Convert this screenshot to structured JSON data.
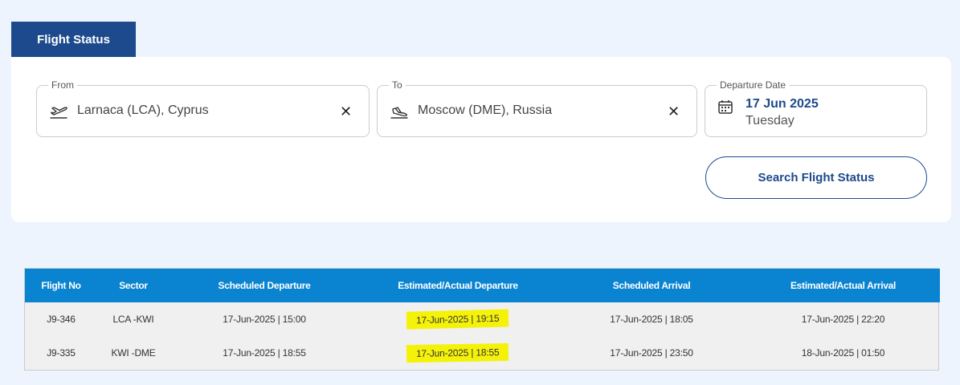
{
  "tab": {
    "label": "Flight Status"
  },
  "search": {
    "from": {
      "legend": "From",
      "value": "Larnaca (LCA), Cyprus",
      "icon": "plane-takeoff-icon"
    },
    "to": {
      "legend": "To",
      "value": "Moscow (DME), Russia",
      "icon": "plane-landing-icon"
    },
    "departure_date": {
      "legend": "Departure Date",
      "date": "17 Jun 2025",
      "weekday": "Tuesday",
      "icon": "calendar-icon"
    },
    "clear_glyph": "✕",
    "button_label": "Search Flight Status"
  },
  "results": {
    "columns": [
      "Flight No",
      "Sector",
      "Scheduled Departure",
      "Estimated/Actual Departure",
      "Scheduled Arrival",
      "Estimated/Actual Arrival"
    ],
    "rows": [
      [
        "J9-346",
        "LCA -KWI",
        "17-Jun-2025 | 15:00",
        "17-Jun-2025 | 19:15",
        "17-Jun-2025 | 18:05",
        "17-Jun-2025 | 22:20"
      ],
      [
        "J9-335",
        "KWI -DME",
        "17-Jun-2025 | 18:55",
        "17-Jun-2025 | 18:55",
        "17-Jun-2025 | 23:50",
        "18-Jun-2025 | 01:50"
      ]
    ],
    "highlight_color": "#f5f20a"
  },
  "colors": {
    "brand": "#1d4a8c",
    "table_header": "#0a84d0",
    "background": "#edf4fd"
  }
}
